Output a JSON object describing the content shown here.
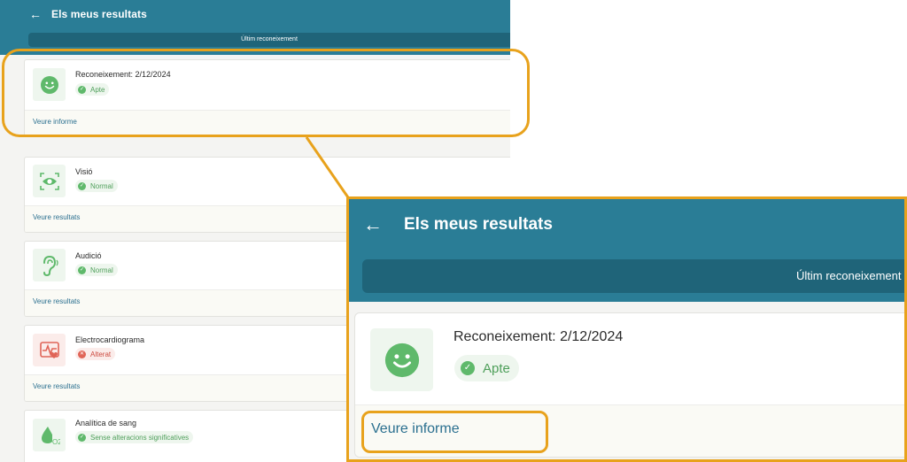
{
  "header": {
    "title": "Els meus resultats",
    "back_icon": "arrow-left-icon"
  },
  "subtab": {
    "label": "Últim reconeixement"
  },
  "cards": [
    {
      "title": "Reconeixement: 2/12/2024",
      "status": "Apte",
      "status_color": "#5fb96b",
      "icon": "smiley-icon",
      "link": "Veure informe"
    },
    {
      "title": "Visió",
      "status": "Normal",
      "status_color": "#5fb96b",
      "icon": "eye-scan-icon",
      "link": "Veure resultats"
    },
    {
      "title": "Audició",
      "status": "Normal",
      "status_color": "#5fb96b",
      "icon": "ear-icon",
      "link": "Veure resultats"
    },
    {
      "title": "Electrocardiograma",
      "status": "Alterat",
      "status_color": "#e06457",
      "icon": "heart-rate-icon",
      "link": "Veure resultats"
    },
    {
      "title": "Analítica de sang",
      "status": "Sense alteracions significatives",
      "status_color": "#5fb96b",
      "icon": "blood-drop-o2-icon",
      "link": ""
    }
  ],
  "colors": {
    "header": "#2a7d96",
    "subtab": "#1f6479",
    "highlight": "#e8a21c",
    "link": "#2a6f8f"
  }
}
